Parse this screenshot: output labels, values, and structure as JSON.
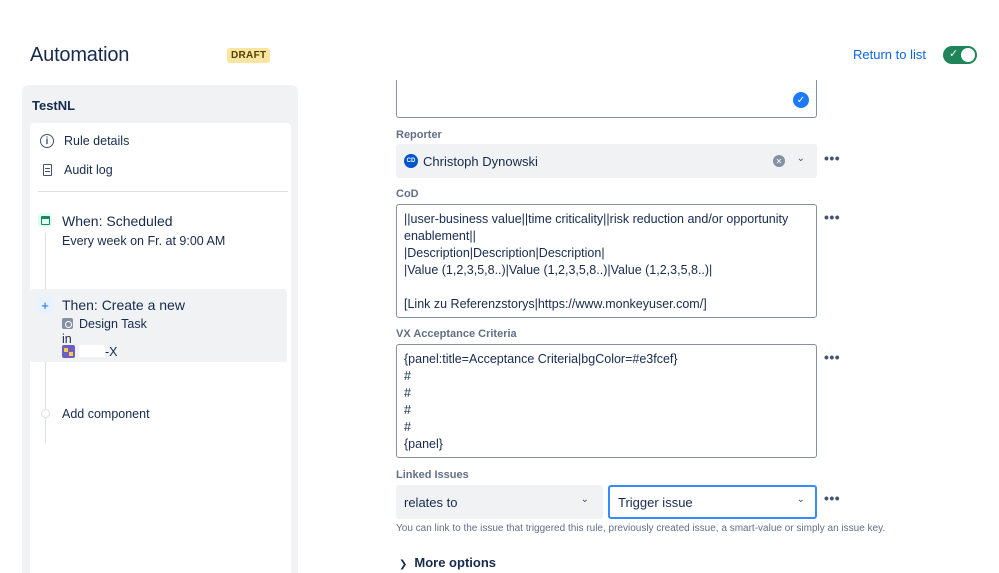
{
  "header": {
    "title": "Automation",
    "badge": "DRAFT",
    "return_link": "Return to list",
    "toggle_check": "✓"
  },
  "sidebar": {
    "rule_name": "TestNL",
    "rule_details": "Rule details",
    "audit_log": "Audit log",
    "trigger": {
      "title": "When: Scheduled",
      "subtitle": "Every week on Fr. at 9:00 AM"
    },
    "action": {
      "title": "Then: Create a new",
      "issue_type": "Design Task",
      "in_label": "in",
      "project_suffix": "-X"
    },
    "add_component": "Add component"
  },
  "form": {
    "reporter": {
      "label": "Reporter",
      "avatar_initials": "CD",
      "value": "Christoph Dynowski"
    },
    "cod": {
      "label": "CoD",
      "value": "||user-business value||time criticality||risk reduction and/or opportunity enablement||\n|Description|Description|Description|\n|Value (1,2,3,5,8..)|Value (1,2,3,5,8..)|Value (1,2,3,5,8..)|\n\n[Link zu Referenzstorys|https://www.monkeyuser.com/]"
    },
    "vx_acceptance": {
      "label": "VX Acceptance Criteria",
      "value": "{panel:title=Acceptance Criteria|bgColor=#e3fcef}\n#\n#\n#\n#\n{panel}"
    },
    "linked_issues": {
      "label": "Linked Issues",
      "relation": "relates to",
      "target": "Trigger issue",
      "helper": "You can link to the issue that triggered this rule, previously created issue, a smart-value or simply an issue key."
    },
    "more_options": "More options",
    "more_dots": "•••"
  },
  "colors": {
    "accent": "#0c66e4",
    "toggle_on": "#1f845a",
    "badge_bg": "#f8e6a0"
  }
}
